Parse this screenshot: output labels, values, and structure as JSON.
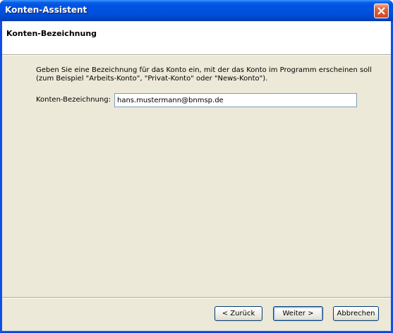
{
  "window": {
    "title": "Konten-Assistent"
  },
  "header": {
    "title": "Konten-Bezeichnung"
  },
  "main": {
    "description_line1": "Geben Sie eine Bezeichnung für das Konto ein, mit der das Konto im Programm erscheinen soll",
    "description_line2": "(zum Beispiel \"Arbeits-Konto\", \"Privat-Konto\" oder \"News-Konto\").",
    "account_name_label": "Konten-Bezeichnung:",
    "account_name_value": "hans.mustermann@bnmsp.de"
  },
  "buttons": {
    "back": "< Zurück",
    "next": "Weiter >",
    "cancel": "Abbrechen"
  },
  "icons": {
    "close": "close-icon"
  },
  "colors": {
    "titlebar": "#0054e3",
    "dialog_background": "#ece9d8",
    "close_button": "#e2613c"
  }
}
